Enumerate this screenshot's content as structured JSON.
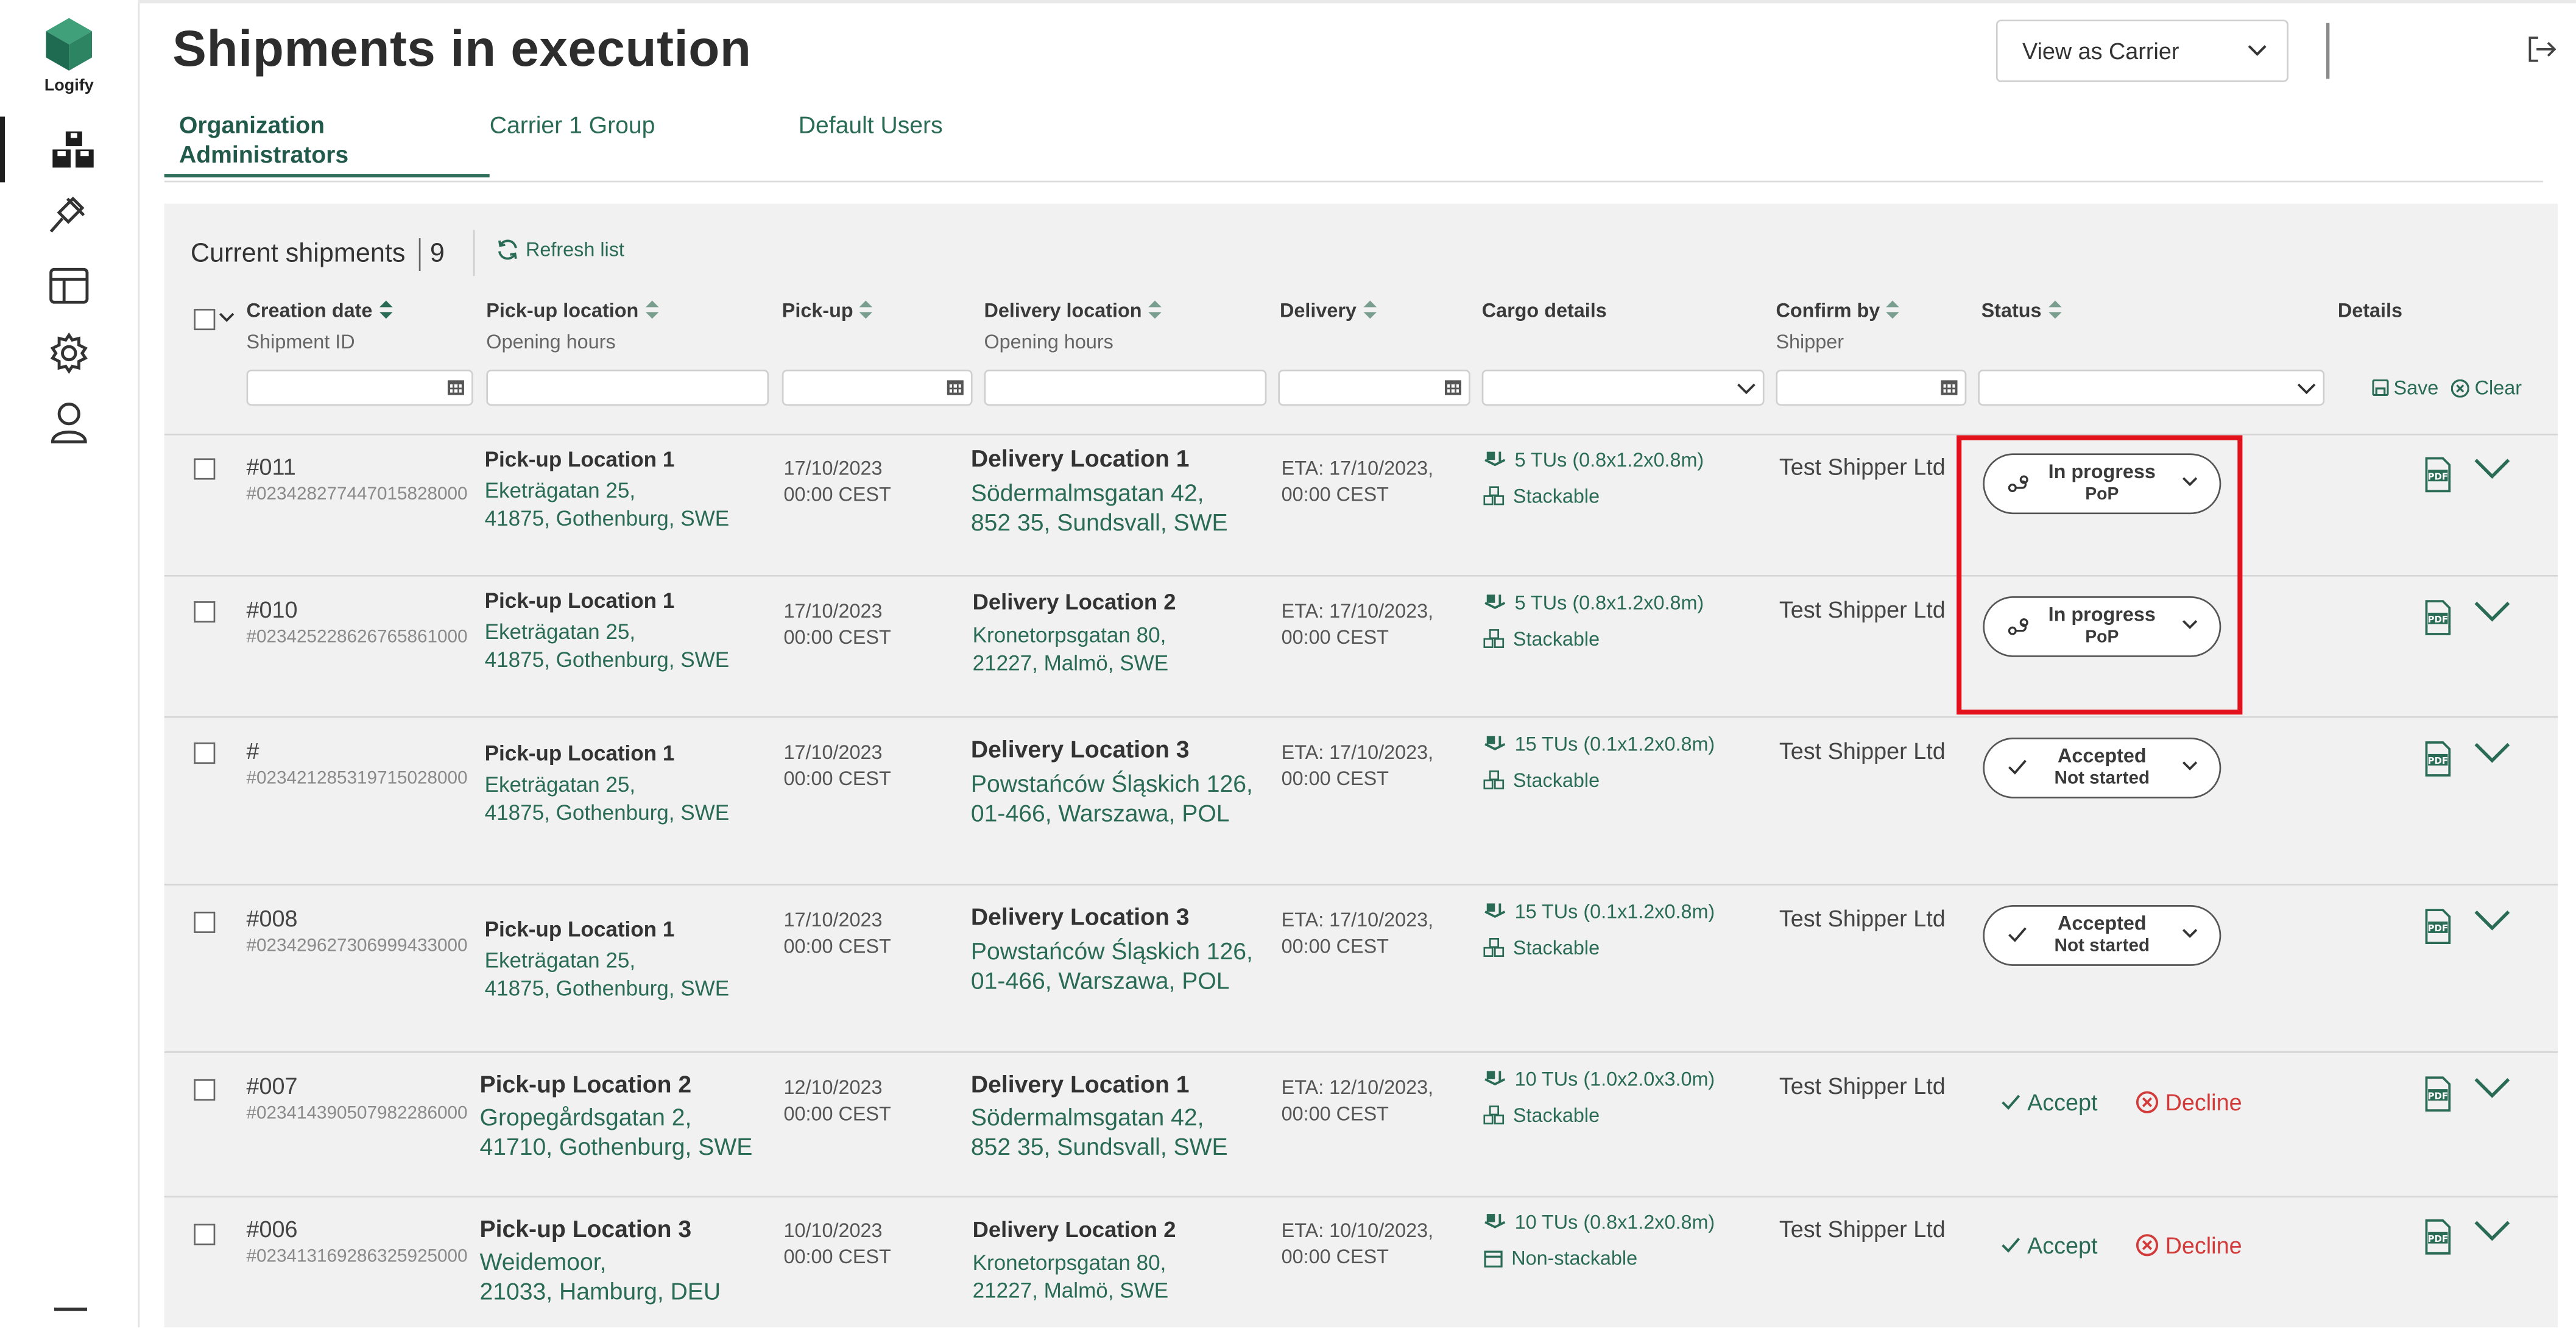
{
  "brand": {
    "name": "Logify"
  },
  "sidebar": {
    "items": [
      {
        "icon": "boxes-icon"
      },
      {
        "icon": "gavel-icon"
      },
      {
        "icon": "layout-icon"
      },
      {
        "icon": "gear-icon"
      },
      {
        "icon": "user-icon"
      }
    ]
  },
  "header": {
    "title": "Shipments in execution",
    "view_select": "View as Carrier"
  },
  "tabs": [
    {
      "label": "Organization Administrators"
    },
    {
      "label": "Carrier 1 Group"
    },
    {
      "label": "Default Users"
    }
  ],
  "panel": {
    "heading": "Current shipments",
    "count": "9",
    "refresh": "Refresh list",
    "save": "Save",
    "clear": "Clear"
  },
  "columns": {
    "creation": "Creation date",
    "creation_sub": "Shipment ID",
    "pickup_loc": "Pick-up location",
    "pickup_loc_sub": "Opening hours",
    "pickup": "Pick-up",
    "delivery_loc": "Delivery location",
    "delivery_loc_sub": "Opening hours",
    "delivery": "Delivery",
    "cargo": "Cargo details",
    "confirm": "Confirm by",
    "confirm_sub": "Shipper",
    "status": "Status",
    "details": "Details"
  },
  "rows": [
    {
      "id": "#011",
      "num": "#023428277447015828000",
      "pu_name": "Pick-up Location 1",
      "pu_addr1": "Eketrägatan 25,",
      "pu_addr2": "41875, Gothenburg, SWE",
      "pu_date": "17/10/2023",
      "pu_time": "00:00 CEST",
      "dl_name": "Delivery Location 1",
      "dl_addr1": "Södermalmsgatan 42,",
      "dl_addr2": "852 35, Sundsvall, SWE",
      "eta": "ETA:  17/10/2023,",
      "eta_time": "00:00 CEST",
      "cargo": "5 TUs (0.8x1.2x0.8m)",
      "stack": "Stackable",
      "shipper": "Test Shipper Ltd",
      "status1": "In progress",
      "status2": "PoP"
    },
    {
      "id": "#010",
      "num": "#023425228626765861000",
      "pu_name": "Pick-up Location 1",
      "pu_addr1": "Eketrägatan 25,",
      "pu_addr2": "41875, Gothenburg, SWE",
      "pu_date": "17/10/2023",
      "pu_time": "00:00 CEST",
      "dl_name": "Delivery Location 2",
      "dl_addr1": "Kronetorpsgatan 80,",
      "dl_addr2": "21227, Malmö, SWE",
      "eta": "ETA:  17/10/2023,",
      "eta_time": "00:00 CEST",
      "cargo": "5 TUs (0.8x1.2x0.8m)",
      "stack": "Stackable",
      "shipper": "Test Shipper Ltd",
      "status1": "In progress",
      "status2": "PoP"
    },
    {
      "id": "#",
      "num": "#023421285319715028000",
      "pu_name": "Pick-up Location 1",
      "pu_addr1": "Eketrägatan 25,",
      "pu_addr2": "41875, Gothenburg, SWE",
      "pu_date": "17/10/2023",
      "pu_time": "00:00 CEST",
      "dl_name": "Delivery Location 3",
      "dl_addr1": "Powstańców Śląskich 126,",
      "dl_addr2": "01-466, Warszawa, POL",
      "eta": "ETA:  17/10/2023,",
      "eta_time": "00:00 CEST",
      "cargo": "15 TUs (0.1x1.2x0.8m)",
      "stack": "Stackable",
      "shipper": "Test Shipper Ltd",
      "status1": "Accepted",
      "status2": "Not started"
    },
    {
      "id": "#008",
      "num": "#023429627306999433000",
      "pu_name": "Pick-up Location 1",
      "pu_addr1": "Eketrägatan 25,",
      "pu_addr2": "41875, Gothenburg, SWE",
      "pu_date": "17/10/2023",
      "pu_time": "00:00 CEST",
      "dl_name": "Delivery Location 3",
      "dl_addr1": "Powstańców Śląskich 126,",
      "dl_addr2": "01-466, Warszawa, POL",
      "eta": "ETA:  17/10/2023,",
      "eta_time": "00:00 CEST",
      "cargo": "15 TUs (0.1x1.2x0.8m)",
      "stack": "Stackable",
      "shipper": "Test Shipper Ltd",
      "status1": "Accepted",
      "status2": "Not started"
    },
    {
      "id": "#007",
      "num": "#023414390507982286000",
      "pu_name": "Pick-up Location 2",
      "pu_addr1": "Gropegårdsgatan 2,",
      "pu_addr2": "41710, Gothenburg, SWE",
      "pu_date": "12/10/2023",
      "pu_time": "00:00 CEST",
      "dl_name": "Delivery Location 1",
      "dl_addr1": "Södermalmsgatan 42,",
      "dl_addr2": "852 35, Sundsvall, SWE",
      "eta": "ETA:  12/10/2023,",
      "eta_time": "00:00 CEST",
      "cargo": "10 TUs (1.0x2.0x3.0m)",
      "stack": "Stackable",
      "shipper": "Test Shipper Ltd",
      "accept": "Accept",
      "decline": "Decline"
    },
    {
      "id": "#006",
      "num": "#023413169286325925000",
      "pu_name": "Pick-up Location 3",
      "pu_addr1": "Weidemoor,",
      "pu_addr2": "21033, Hamburg, DEU",
      "pu_date": "10/10/2023",
      "pu_time": "00:00 CEST",
      "dl_name": "Delivery Location 2",
      "dl_addr1": "Kronetorpsgatan 80,",
      "dl_addr2": "21227, Malmö, SWE",
      "eta": "ETA:  10/10/2023,",
      "eta_time": "00:00 CEST",
      "cargo": "10 TUs (0.8x1.2x0.8m)",
      "stack": "Non-stackable",
      "shipper": "Test Shipper Ltd",
      "accept": "Accept",
      "decline": "Decline"
    }
  ],
  "colors": {
    "accent": "#2a6b55",
    "decline": "#d33a3a",
    "highlight": "#e2111b"
  }
}
